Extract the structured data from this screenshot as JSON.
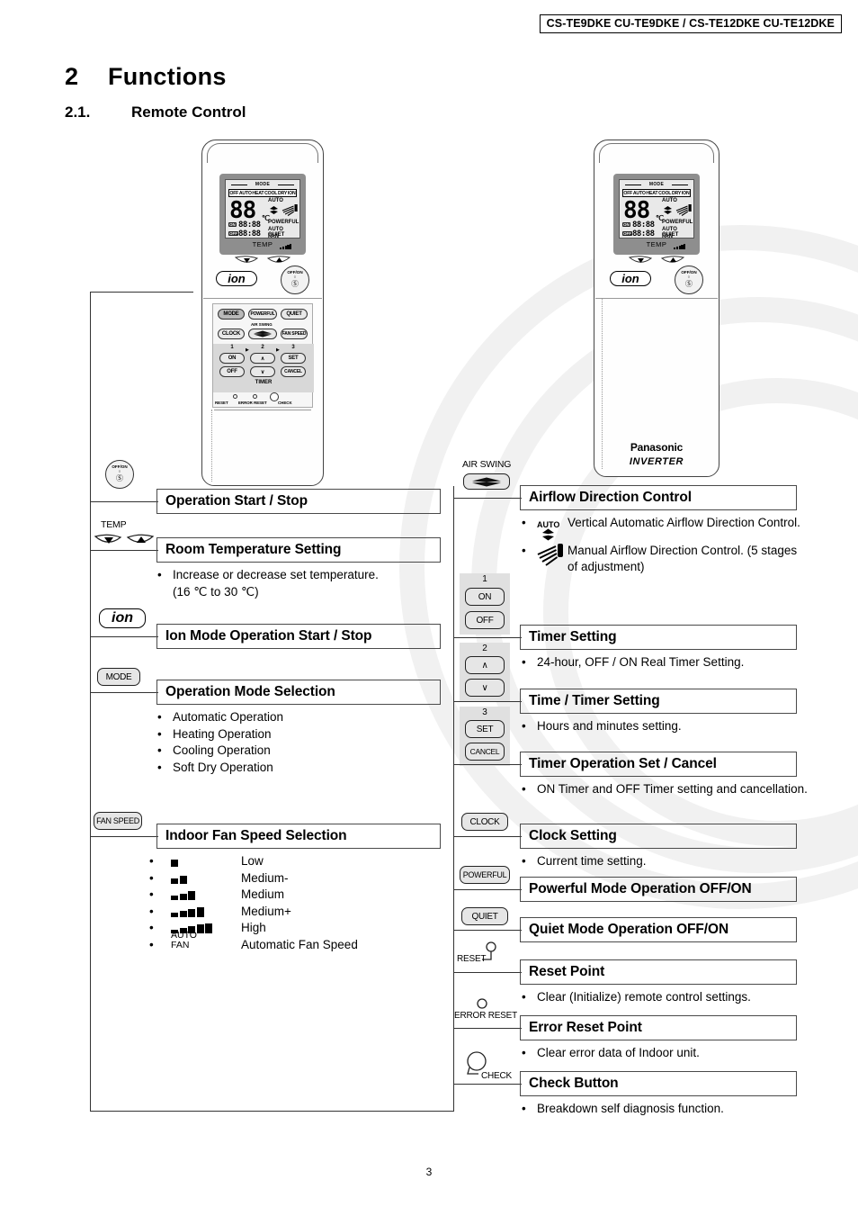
{
  "header": {
    "model_codes": "CS-TE9DKE CU-TE9DKE / CS-TE12DKE CU-TE12DKE"
  },
  "section": {
    "number": "2",
    "title": "Functions",
    "sub_number": "2.1.",
    "sub_title": "Remote Control"
  },
  "remote": {
    "lcd": {
      "mode_label": "MODE",
      "modes": [
        "OFF",
        "AUTO",
        "HEAT",
        "COOL",
        "DRY",
        "ION"
      ],
      "temperature_digits": "88",
      "temperature_unit": "℃",
      "auto_label": "AUTO",
      "on_tag": "ON",
      "off_tag": "OFF",
      "on_time": "88:88",
      "off_time": "88:88",
      "powerful": "POWERFUL",
      "auto_quiet": "AUTO QUIET",
      "fan": "FAN"
    },
    "temp_label": "TEMP",
    "ion_label": "ion",
    "power_label": "OFF/ON",
    "buttons": {
      "mode": "MODE",
      "powerful": "POWERFUL",
      "quiet": "QUIET",
      "clock": "CLOCK",
      "air_swing": "AIR SWING",
      "fan_speed": "FAN SPEED",
      "on": "ON",
      "off": "OFF",
      "set": "SET",
      "cancel": "CANCEL",
      "timer": "TIMER",
      "step1": "1",
      "step2": "2",
      "step3": "3",
      "reset": "RESET",
      "error_reset": "ERROR RESET",
      "check": "CHECK"
    },
    "brand": "Panasonic",
    "brand_sub": "INVERTER"
  },
  "left_column": [
    {
      "icon": "power-off-on-icon",
      "icon_label": "OFF/ON",
      "title": "Operation Start / Stop",
      "details": []
    },
    {
      "icon": "temp-up-down-icon",
      "icon_label": "TEMP",
      "title": "Room Temperature Setting",
      "details": [
        "Increase or decrease set temperature.",
        "(16 ℃ to 30 ℃)"
      ]
    },
    {
      "icon": "ion-icon",
      "icon_label": "ion",
      "title": "Ion Mode Operation Start / Stop",
      "details": []
    },
    {
      "icon": "mode-button-icon",
      "icon_label": "MODE",
      "title": "Operation Mode Selection",
      "details": [
        "Automatic Operation",
        "Heating Operation",
        "Cooling Operation",
        "Soft Dry Operation"
      ]
    },
    {
      "icon": "fan-speed-button-icon",
      "icon_label": "FAN SPEED",
      "title": "Indoor Fan Speed Selection",
      "details": []
    }
  ],
  "fan_speeds": [
    {
      "bars": 1,
      "label": "Low"
    },
    {
      "bars": 2,
      "label": "Medium-"
    },
    {
      "bars": 3,
      "label": "Medium"
    },
    {
      "bars": 4,
      "label": "Medium+"
    },
    {
      "bars": 5,
      "label": "High"
    },
    {
      "bars": 0,
      "icon_text_1": "AUTO",
      "icon_text_2": "FAN",
      "label": "Automatic Fan Speed"
    }
  ],
  "right_column": [
    {
      "icon": "air-swing-button-icon",
      "icon_label": "AIR SWING",
      "title": "Airflow Direction Control",
      "details": [
        {
          "icon": "auto-swing-icon",
          "icon_text": "AUTO",
          "text": "Vertical Automatic Airflow Direction Control."
        },
        {
          "icon": "manual-louver-icon",
          "text": "Manual Airflow Direction Control. (5 stages of adjustment)"
        }
      ]
    },
    {
      "icon": "timer-on-off-button-icon",
      "icon_label": "1",
      "title": "Timer Setting",
      "details": [
        {
          "text": "24-hour, OFF / ON Real Timer Setting."
        }
      ]
    },
    {
      "icon": "up-down-arrow-button-icon",
      "icon_label": "2",
      "title": "Time / Timer Setting",
      "details": [
        {
          "text": "Hours and minutes setting."
        }
      ]
    },
    {
      "icon": "set-cancel-button-icon",
      "icon_label": "3",
      "title": "Timer Operation Set / Cancel",
      "details": [
        {
          "text": "ON Timer and OFF Timer setting and cancellation."
        }
      ]
    },
    {
      "icon": "clock-button-icon",
      "icon_label": "CLOCK",
      "title": "Clock Setting",
      "details": [
        {
          "text": "Current time setting."
        }
      ]
    },
    {
      "icon": "powerful-button-icon",
      "icon_label": "POWERFUL",
      "title": "Powerful Mode Operation OFF/ON",
      "details": []
    },
    {
      "icon": "quiet-button-icon",
      "icon_label": "QUIET",
      "title": "Quiet Mode Operation OFF/ON",
      "details": []
    },
    {
      "icon": "reset-point-icon",
      "icon_label": "RESET",
      "title": "Reset Point",
      "details": [
        {
          "text": "Clear (Initialize) remote control settings."
        }
      ]
    },
    {
      "icon": "error-reset-point-icon",
      "icon_label": "ERROR RESET",
      "title": "Error Reset Point",
      "details": [
        {
          "text": "Clear error data of Indoor unit."
        }
      ]
    },
    {
      "icon": "check-button-icon",
      "icon_label": "CHECK",
      "title": "Check Button",
      "details": [
        {
          "text": "Breakdown self diagnosis function."
        }
      ]
    }
  ],
  "footer": {
    "page_number": "3"
  }
}
